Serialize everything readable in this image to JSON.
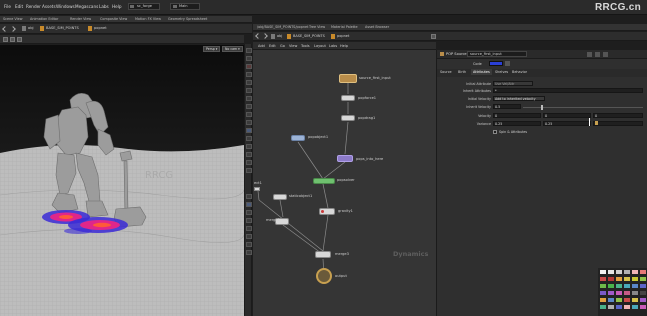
{
  "menubar": {
    "items": [
      "File",
      "Edit",
      "Render",
      "Assets",
      "Windows",
      "Megascans",
      "Labs",
      "Help"
    ],
    "desktop": "sc_forge",
    "scene": "Main"
  },
  "watermark": "RRCG.cn",
  "viewer": {
    "tabs": [
      "Scene View",
      "Animation Editor",
      "Render View",
      "Composite View",
      "Motion FX View",
      "Geometry Spreadsheet"
    ],
    "path": [
      "obj",
      "BASE_SIM_POINTS",
      "popnet"
    ],
    "persp_label": "Persp ▾",
    "cam_label": "No cam ▾",
    "overlay_text": "RRCG"
  },
  "network": {
    "tabs": [
      "/obj/BASE_SIM_POINTS/popnet",
      "Tree View",
      "Material Palette",
      "Asset Browser"
    ],
    "path": [
      "obj",
      "BASE_SIM_POINTS",
      "popnet"
    ],
    "menus": [
      "Add",
      "Edit",
      "Go",
      "View",
      "Tools",
      "Layout",
      "Labs",
      "Help"
    ],
    "context_label": "Dynamics",
    "nodes": {
      "source": "source_first_input",
      "popforce1": "popforce1",
      "popdrag1": "popdrag1",
      "popobject1": "popobject1",
      "merge2": "merge2",
      "popsolver": "popsolver",
      "pops_into_here": "pops_into_here",
      "staticobject1": "staticobject1",
      "merge1": "merge1",
      "gravity1": "gravity1",
      "merge3": "merge3",
      "output": "output",
      "cut_label": "ect1"
    }
  },
  "params": {
    "node_type": "POP Source",
    "node_name": "source_first_input",
    "code_label": "Code",
    "tabs": [
      "Source",
      "Birth",
      "Attributes",
      "Shelves",
      "Behavior"
    ],
    "rows": {
      "initial_attr_label": "Initial Attribute",
      "initial_attr_value": "Use Vel/Attr",
      "inherit_attr_label": "Inherit Attributes",
      "inherit_attr_value": "*",
      "initial_velocity_label": "Initial Velocity",
      "initial_velocity_value": "Add to inherited velocity",
      "inherit_velocity_label": "Inherit Velocity",
      "inherit_velocity_value": "0.5",
      "velocity_label": "Velocity",
      "velocity_x": "0",
      "velocity_y": "0",
      "velocity_z": "0",
      "variance_label": "Variance",
      "variance_x": "0.25",
      "variance_y": "0.25",
      "variance_z": "0",
      "spin_label": "Spin & Attributes"
    }
  },
  "palette_colors": [
    "#f2f2f2",
    "#e6e6e6",
    "#cfcfcf",
    "#b0b0b0",
    "#f0b5b5",
    "#e77878",
    "#c94a4a",
    "#b33636",
    "#e0a040",
    "#d6c24a",
    "#c8c832",
    "#8fc24a",
    "#6fb84a",
    "#4ab24a",
    "#4ab28a",
    "#4aa8b8",
    "#5a86c8",
    "#5a64c8",
    "#7a5ac8",
    "#a05ac8",
    "#c85ab8",
    "#c85a86",
    "#888888",
    "#444444"
  ]
}
